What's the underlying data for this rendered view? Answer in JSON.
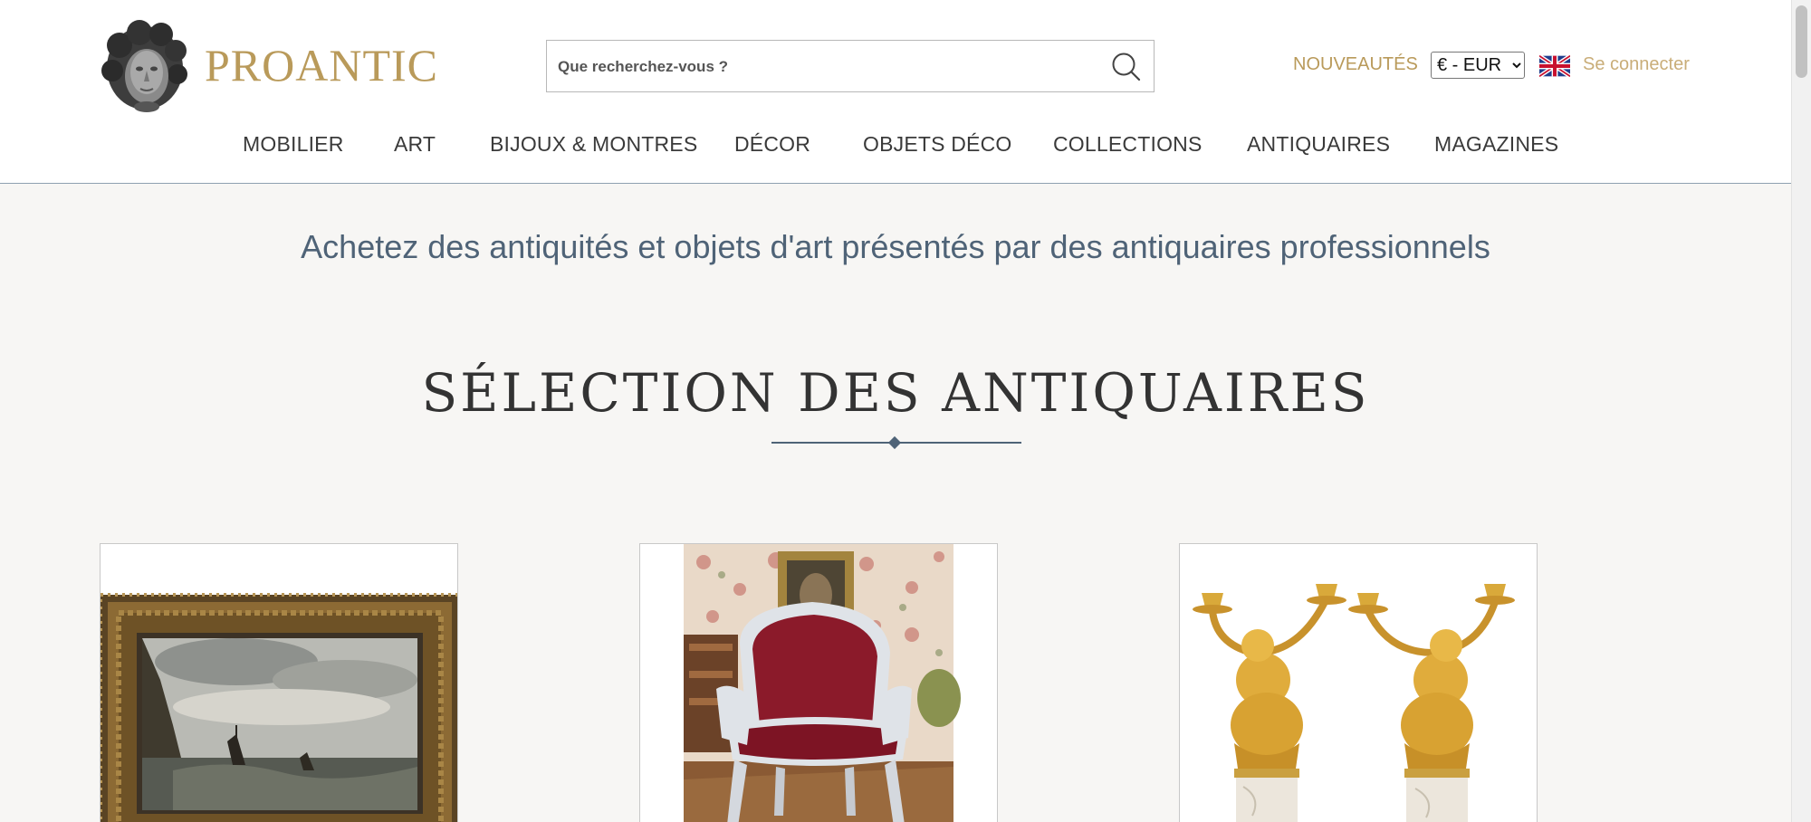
{
  "header": {
    "logo_text": "PROANTIC",
    "search_placeholder": "Que recherchez-vous ?",
    "new_link": "NOUVEAUTÉS",
    "currency_selected": "€ - EUR",
    "language_flag": "uk-flag-icon",
    "login_link": "Se connecter"
  },
  "nav": {
    "items": [
      "MOBILIER",
      "ART",
      "BIJOUX & MONTRES",
      "DÉCOR",
      "OBJETS DÉCO",
      "COLLECTIONS",
      "ANTIQUAIRES",
      "MAGAZINES"
    ]
  },
  "main": {
    "tagline": "Achetez des antiquités et objets d'art présentés par des antiquaires professionnels",
    "section_title": "SÉLECTION DES ANTIQUAIRES"
  },
  "cards": [
    {
      "image": "seascape-painting-in-gilded-frame"
    },
    {
      "image": "louis-xv-armchair-red-velvet"
    },
    {
      "image": "pair-of-gilt-bronze-cherub-candelabra"
    }
  ],
  "colors": {
    "brand_gold": "#b99a5a",
    "nav_text": "#3a3a3a",
    "tagline_blue": "#4f6377",
    "background": "#f7f6f4"
  }
}
